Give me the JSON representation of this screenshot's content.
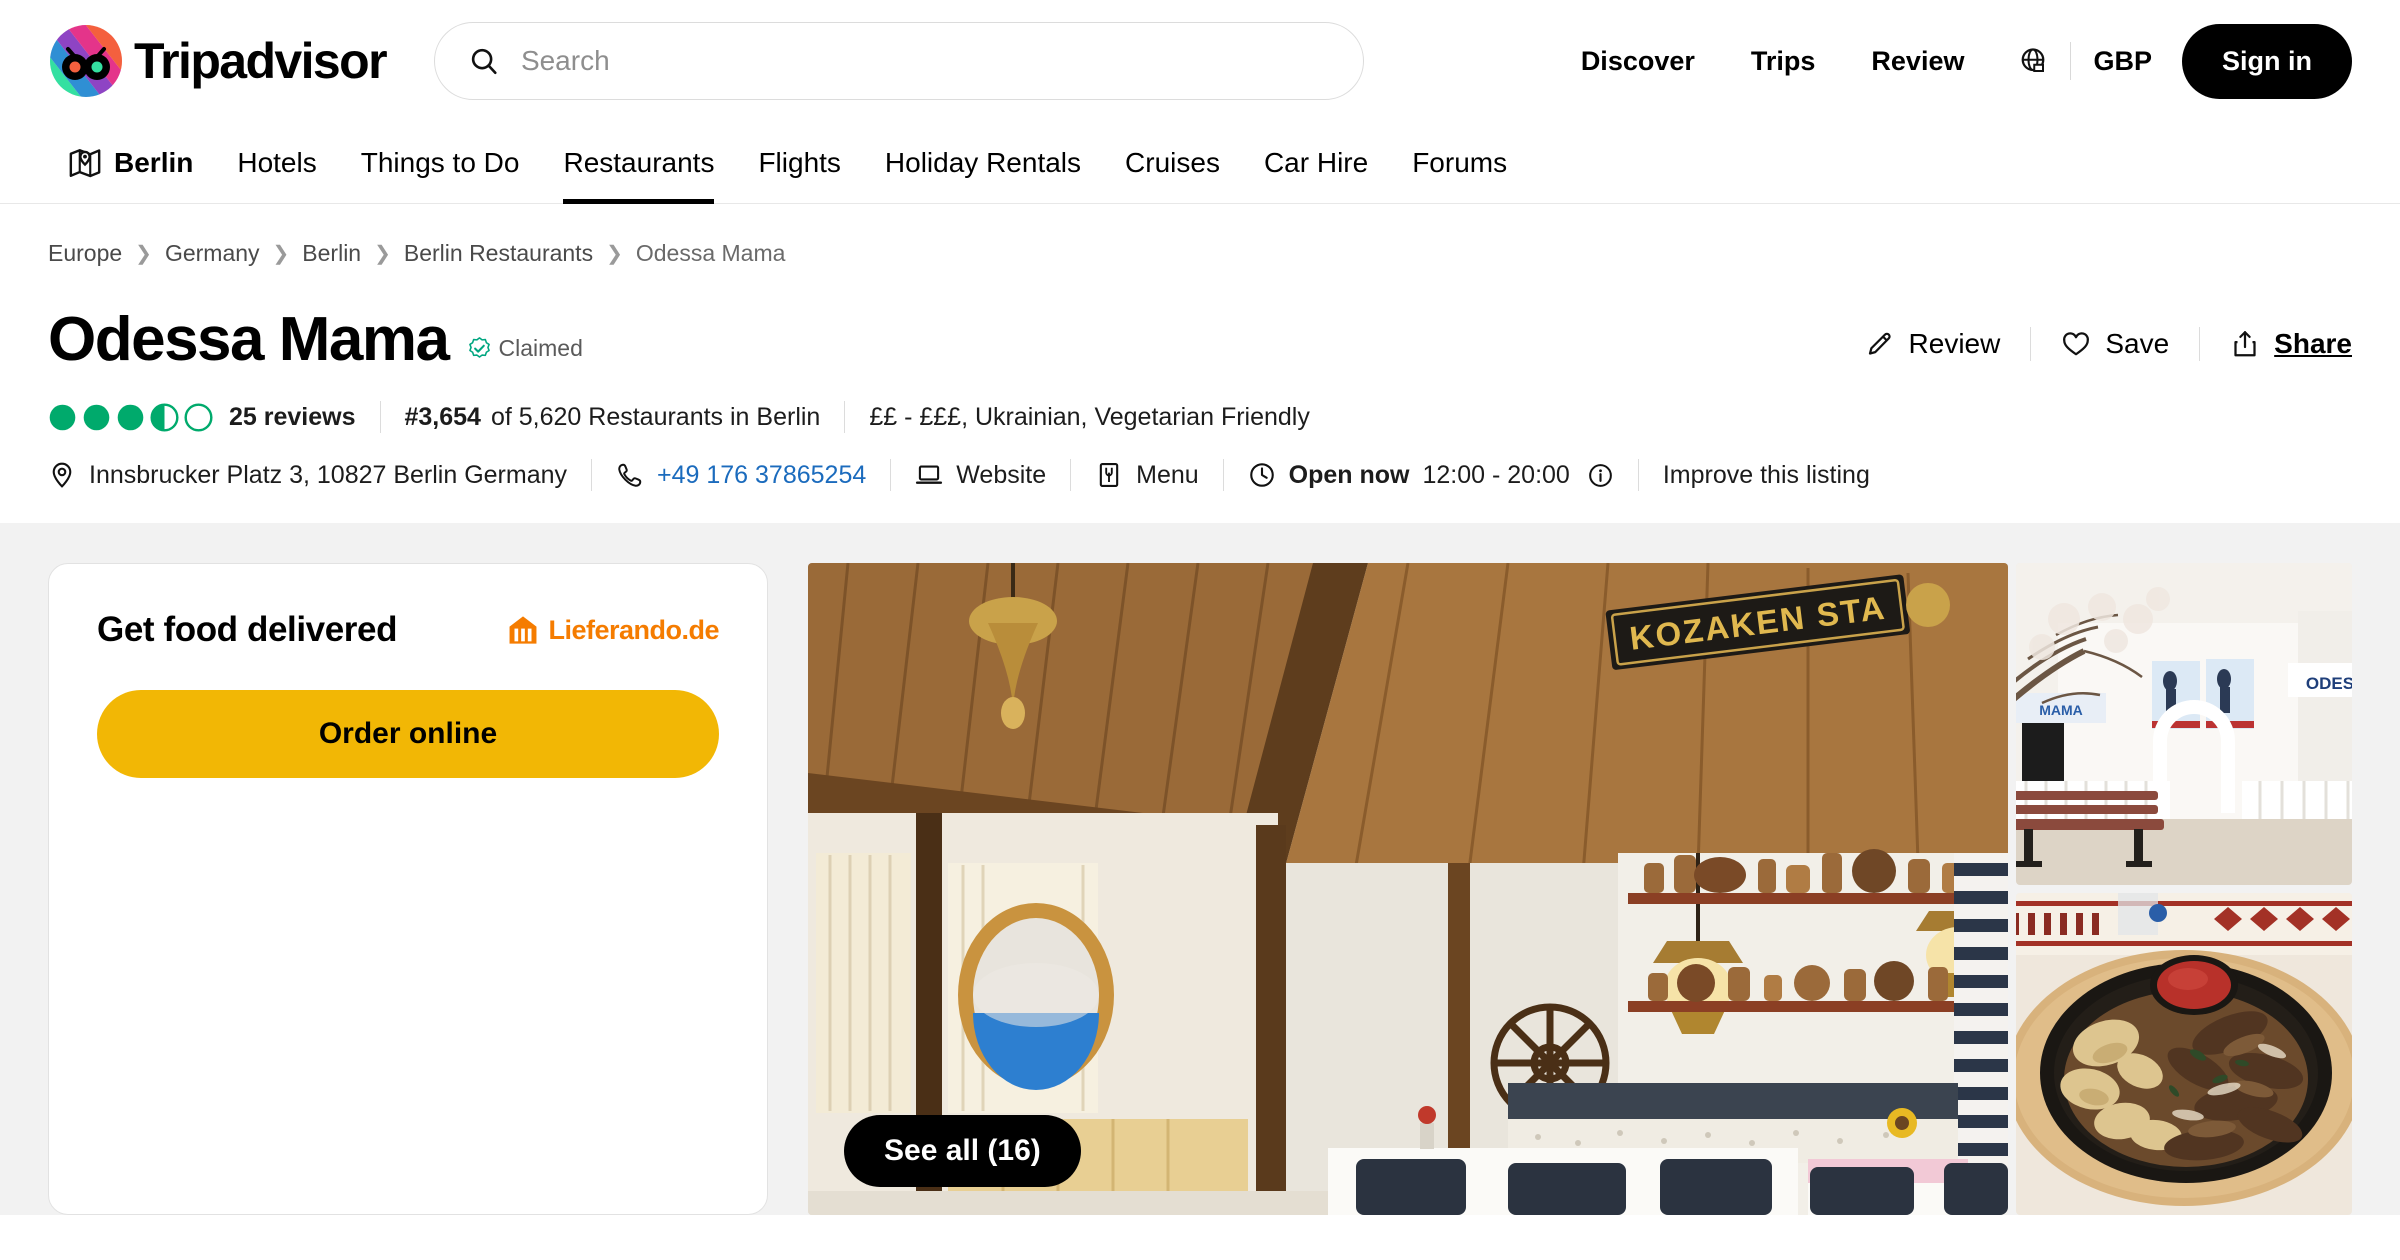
{
  "header": {
    "brand": "Tripadvisor",
    "search": {
      "value": "",
      "placeholder": "Search"
    },
    "nav": [
      {
        "label": "Discover"
      },
      {
        "label": "Trips"
      },
      {
        "label": "Review"
      }
    ],
    "currency": "GBP",
    "signin_label": "Sign in"
  },
  "subnav": {
    "location": "Berlin",
    "items": [
      {
        "label": "Hotels",
        "active": false
      },
      {
        "label": "Things to Do",
        "active": false
      },
      {
        "label": "Restaurants",
        "active": true
      },
      {
        "label": "Flights",
        "active": false
      },
      {
        "label": "Holiday Rentals",
        "active": false
      },
      {
        "label": "Cruises",
        "active": false
      },
      {
        "label": "Car Hire",
        "active": false
      },
      {
        "label": "Forums",
        "active": false
      }
    ]
  },
  "breadcrumb": [
    {
      "label": "Europe"
    },
    {
      "label": "Germany"
    },
    {
      "label": "Berlin"
    },
    {
      "label": "Berlin Restaurants"
    },
    {
      "label": "Odessa Mama"
    }
  ],
  "poi": {
    "title": "Odessa Mama",
    "claimed_label": "Claimed",
    "rating": 3.5,
    "bubbles_total": 5,
    "reviews_label": "25 reviews",
    "rank_number": "#3,654",
    "rank_rest": "of 5,620 Restaurants in Berlin",
    "cuisine": "££ - £££, Ukrainian, Vegetarian Friendly",
    "address": "Innsbrucker Platz 3, 10827 Berlin Germany",
    "phone": "+49 176 37865254",
    "website_label": "Website",
    "menu_label": "Menu",
    "open_status": "Open now",
    "hours": "12:00 - 20:00",
    "improve_label": "Improve this listing"
  },
  "actions": [
    {
      "label": "Review",
      "icon": "pencil-icon"
    },
    {
      "label": "Save",
      "icon": "heart-icon"
    },
    {
      "label": "Share",
      "icon": "share-icon"
    }
  ],
  "delivery": {
    "title": "Get food delivered",
    "provider": "Lieferando",
    "provider_suffix": ".de",
    "order_label": "Order online"
  },
  "photos": {
    "see_all_label": "See all (16)",
    "main_sign_text": "KOZAKEN STA",
    "thumb_sign_text": "ODES"
  },
  "colors": {
    "brand_green": "#00aa6c",
    "accent_yellow": "#f2b705",
    "lieferando_orange": "#f57c00",
    "link_blue": "#1b6bbd",
    "page_bg": "#f2f2f2"
  }
}
